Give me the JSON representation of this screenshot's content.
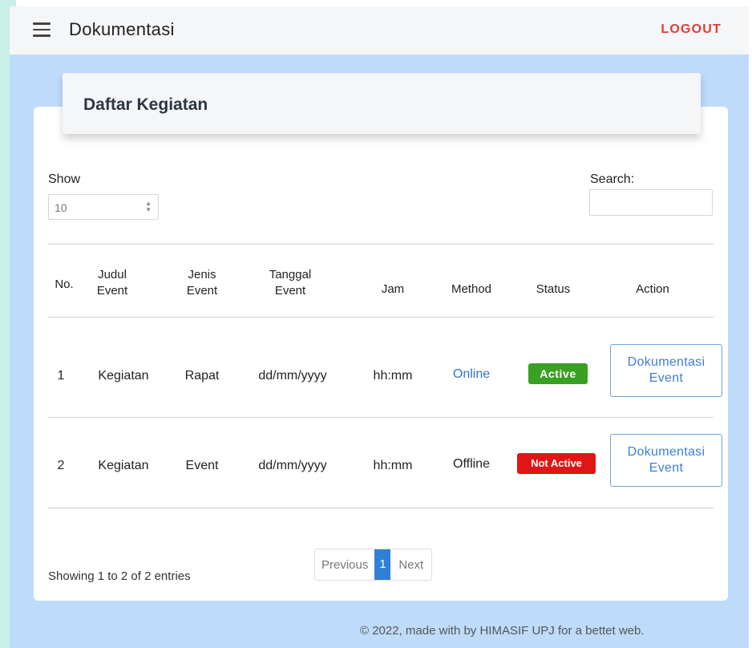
{
  "header": {
    "title": "Dokumentasi",
    "logout_label": "LOGOUT"
  },
  "card": {
    "title": "Daftar Kegiatan",
    "show_label": "Show",
    "show_value": "10",
    "search_label": "Search:",
    "search_value": ""
  },
  "table": {
    "columns": {
      "no": "No.",
      "judul_1": "Judul",
      "judul_2": "Event",
      "jenis_1": "Jenis",
      "jenis_2": "Event",
      "tanggal_1": "Tanggal",
      "tanggal_2": "Event",
      "jam": "Jam",
      "method": "Method",
      "status": "Status",
      "action": "Action"
    },
    "rows": [
      {
        "no": "1",
        "judul": "Kegiatan",
        "jenis": "Rapat",
        "tanggal": "dd/mm/yyyy",
        "jam": "hh:mm",
        "method": "Online",
        "status": "Active",
        "action_line1": "Dokumentasi",
        "action_line2": "Event"
      },
      {
        "no": "2",
        "judul": "Kegiatan",
        "jenis": "Event",
        "tanggal": "dd/mm/yyyy",
        "jam": "hh:mm",
        "method": "Offline",
        "status": "Not Active",
        "action_line1": "Dokumentasi",
        "action_line2": "Event"
      }
    ]
  },
  "pagination": {
    "info": "Showing 1 to 2 of 2 entries",
    "previous": "Previous",
    "current": "1",
    "next": "Next"
  },
  "footer": {
    "text": "© 2022, made with by HIMASIF UPJ for a bettet web."
  },
  "colors": {
    "accent": "#2f80d6",
    "logout": "#e53935",
    "active": "#3aa023",
    "inactive": "#e01515",
    "online_text": "#2f73c9",
    "page_bg": "#bedcfa"
  },
  "icons": {
    "menu": "hamburger-menu-icon",
    "select_arrows": "sort-arrows-icon"
  }
}
